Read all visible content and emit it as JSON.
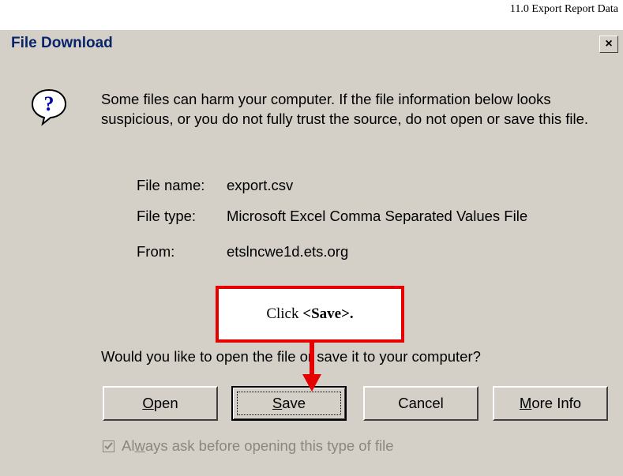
{
  "page_header": "11.0 Export Report Data",
  "dialog": {
    "title": "File Download",
    "close_label": "×",
    "warning": "Some files can harm your computer. If the file information below looks suspicious, or you do not fully trust the source, do not open or save this file.",
    "file_info": [
      {
        "label": "File name:",
        "value": "export.csv"
      },
      {
        "label": "File type:",
        "value": "Microsoft Excel Comma Separated Values File"
      },
      {
        "label": "From:",
        "value": "etslncwe1d.ets.org"
      }
    ],
    "question": "Would you like to open the file or save it to your computer?",
    "buttons": {
      "open_pre": "",
      "open_u": "O",
      "open_post": "pen",
      "save_pre": "",
      "save_u": "S",
      "save_post": "ave",
      "cancel": "Cancel",
      "more_pre": "",
      "more_u": "M",
      "more_post": "ore Info"
    },
    "checkbox": {
      "pre": "Al",
      "u": "w",
      "post": "ays ask before opening this type of file",
      "checked": true
    }
  },
  "callout": {
    "prefix": "Click ",
    "bold": "<Save>."
  },
  "icons": {
    "help": "question-mark-bubble-icon",
    "close": "close-icon",
    "check": "checkmark-icon"
  },
  "colors": {
    "dialog_bg": "#d4d0c8",
    "title_text": "#0a246a",
    "callout_border": "#e60000"
  }
}
